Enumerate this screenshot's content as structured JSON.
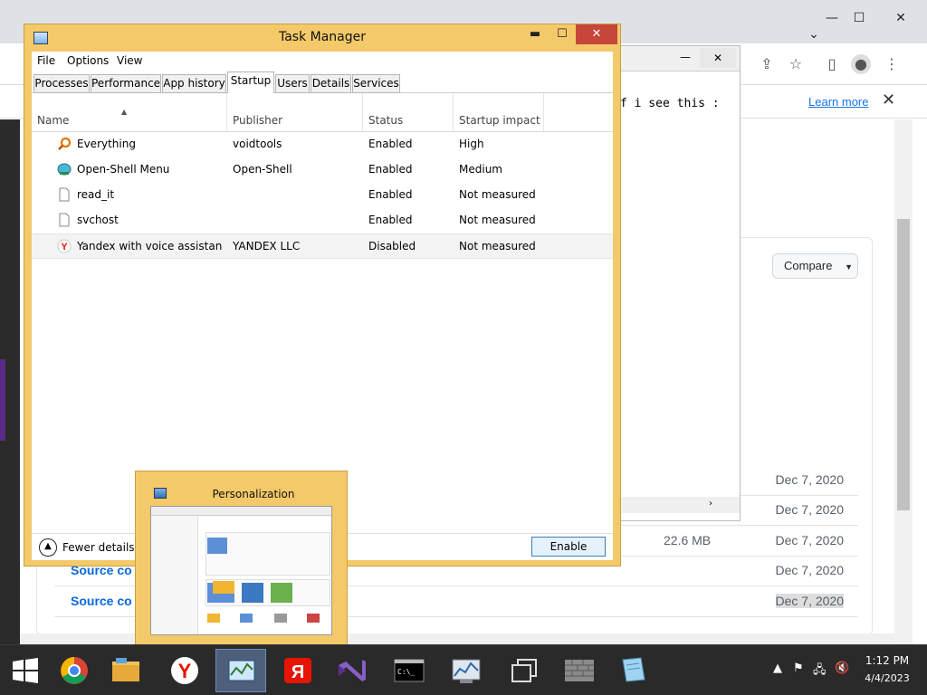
{
  "browser": {
    "learn_more": "Learn more",
    "compare_label": "Compare",
    "rows": [
      {
        "date": "Dec 7, 2020",
        "size": "",
        "link": ""
      },
      {
        "date": "Dec 7, 2020",
        "size": "",
        "link": ""
      },
      {
        "date": "Dec 7, 2020",
        "size": "22.6 MB",
        "link": ""
      },
      {
        "date": "Dec 7, 2020",
        "size": "",
        "link": "Source co"
      },
      {
        "date": "Dec 7, 2020",
        "size": "",
        "link": "Source co"
      }
    ]
  },
  "code_window": {
    "text": "f i see this :"
  },
  "task_manager": {
    "title": "Task Manager",
    "menu": [
      "File",
      "Options",
      "View"
    ],
    "tabs": [
      "Processes",
      "Performance",
      "App history",
      "Startup",
      "Users",
      "Details",
      "Services"
    ],
    "active_tab": "Startup",
    "columns": [
      "Name",
      "Publisher",
      "Status",
      "Startup impact"
    ],
    "rows": [
      {
        "icon": "everything-search-icon",
        "name": "Everything",
        "publisher": "voidtools",
        "status": "Enabled",
        "impact": "High"
      },
      {
        "icon": "open-shell-icon",
        "name": "Open-Shell Menu",
        "publisher": "Open-Shell",
        "status": "Enabled",
        "impact": "Medium"
      },
      {
        "icon": "file-icon",
        "name": "read_it",
        "publisher": "",
        "status": "Enabled",
        "impact": "Not measured"
      },
      {
        "icon": "file-icon",
        "name": "svchost",
        "publisher": "",
        "status": "Enabled",
        "impact": "Not measured"
      },
      {
        "icon": "yandex-icon",
        "name": "Yandex with voice assistant ...",
        "publisher": "YANDEX LLC",
        "status": "Disabled",
        "impact": "Not measured"
      }
    ],
    "fewer_details": "Fewer details",
    "enable_button": "Enable"
  },
  "thumbnail": {
    "title": "Personalization"
  },
  "taskbar": {
    "time": "1:12 PM",
    "date": "4/4/2023",
    "apps": [
      "start-icon",
      "chrome-icon",
      "file-explorer-icon",
      "yandex-browser-icon",
      "task-manager-icon",
      "yandex-icon",
      "visual-studio-icon",
      "command-prompt-icon",
      "resource-monitor-icon",
      "window-switcher-icon",
      "firewall-icon",
      "notepad-icon"
    ]
  },
  "colors": {
    "tm_frame": "#f3c969",
    "tm_close": "#c7463a",
    "link": "#1a73e8",
    "taskbar": "#2a2a2a"
  }
}
